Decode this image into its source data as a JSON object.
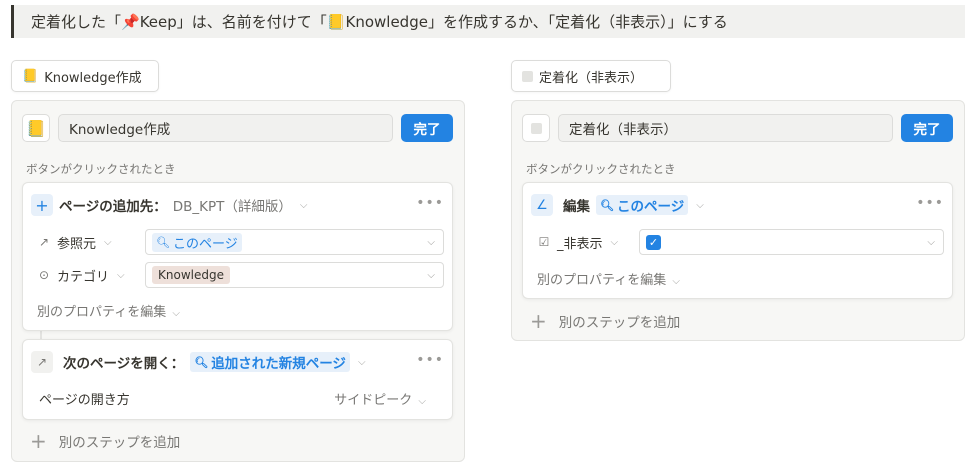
{
  "banner": {
    "prefix": "定着化した「",
    "pin_emoji": "📌",
    "keep": " Keep",
    "middle": "」は、名前を付けて「 ",
    "knowledge_emoji": "📒",
    "knowledge": "Knowledge",
    "suffix": "」を作成するか、「定着化（非表示）」にする"
  },
  "left": {
    "trigger_emoji": "📒",
    "trigger_label": "Knowledge作成",
    "panel_emoji": "📒",
    "name_value": "Knowledge作成",
    "done_label": "完了",
    "when_clicked": "ボタンがクリックされたとき",
    "step1": {
      "title": "ページの追加先：",
      "target_db": "DB_KPT（詳細版）",
      "props": [
        {
          "name": "参照元",
          "value": "このページ"
        },
        {
          "name": "カテゴリ",
          "value": "Knowledge"
        }
      ],
      "more_props": "別のプロパティを編集"
    },
    "step2": {
      "title": "次のページを開く：",
      "target": "追加された新規ページ",
      "open_how_label": "ページの開き方",
      "open_how_value": "サイドピーク"
    },
    "add_step": "別のステップを追加"
  },
  "right": {
    "trigger_label": "定着化（非表示）",
    "name_value": "定着化（非表示）",
    "done_label": "完了",
    "when_clicked": "ボタンがクリックされたとき",
    "step1": {
      "title": "編集",
      "target": "このページ",
      "props": [
        {
          "name": "_非表示",
          "checked": true
        }
      ],
      "more_props": "別のプロパティを編集"
    },
    "add_step": "別のステップを追加"
  },
  "colors": {
    "accent": "#2383e2",
    "panel_bg": "#f7f7f5",
    "banner_bg": "#f1f1ef",
    "tag_bg": "#eee0da"
  }
}
